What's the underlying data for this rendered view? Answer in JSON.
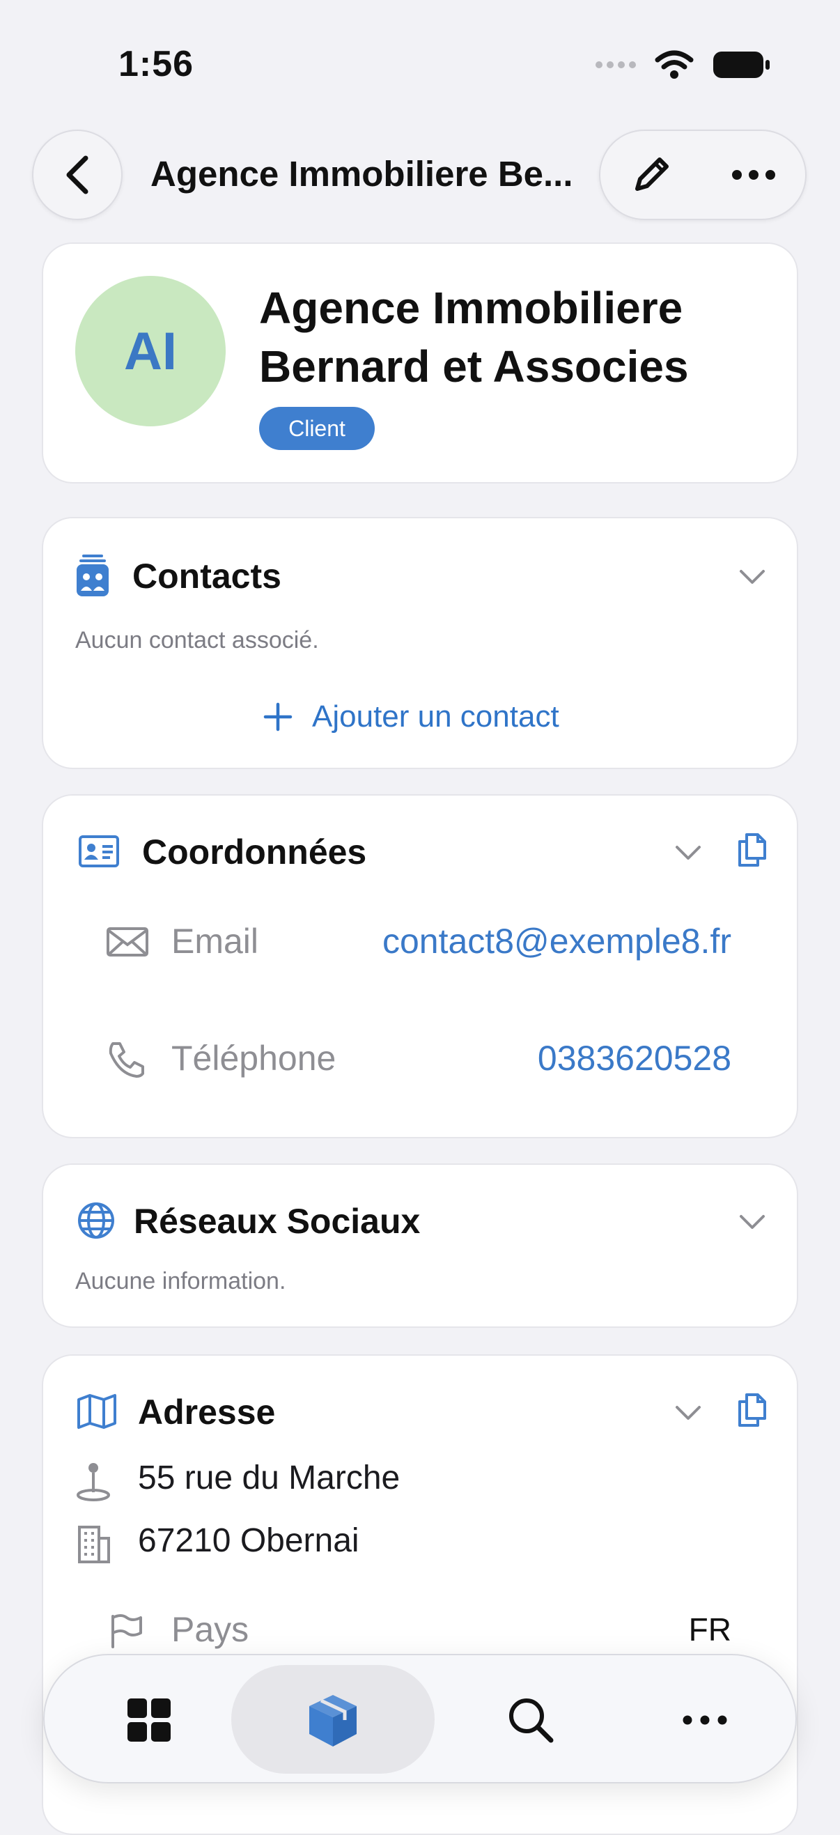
{
  "status_bar": {
    "time": "1:56"
  },
  "nav": {
    "title": "Agence Immobiliere Be..."
  },
  "header": {
    "avatar_initials": "AI",
    "company_name": "Agence Immobiliere Bernard et Associes",
    "badge": "Client"
  },
  "contacts": {
    "title": "Contacts",
    "empty": "Aucun contact associé.",
    "add_label": "Ajouter un contact"
  },
  "coordonnees": {
    "title": "Coordonnées",
    "email_label": "Email",
    "email_value": "contact8@exemple8.fr",
    "phone_label": "Téléphone",
    "phone_value": "0383620528"
  },
  "reseaux": {
    "title": "Réseaux Sociaux",
    "empty": "Aucune information."
  },
  "adresse": {
    "title": "Adresse",
    "street": "55 rue du Marche",
    "city": "67210 Obernai",
    "country_label": "Pays",
    "country_value": "FR"
  },
  "tabbar": {
    "items": [
      "grid-icon",
      "box-icon",
      "search-icon",
      "more-icon"
    ],
    "active_index": 1
  },
  "colors": {
    "accent": "#3f7fcf",
    "link": "#2f74c8",
    "avatar_bg": "#c9e8c0",
    "background": "#f2f2f6"
  }
}
